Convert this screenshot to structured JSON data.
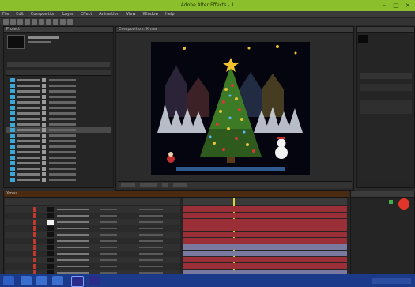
{
  "window": {
    "title": "Adobe After Effects - 1"
  },
  "menu": {
    "items": [
      "File",
      "Edit",
      "Composition",
      "Layer",
      "Effect",
      "Animation",
      "View",
      "Window",
      "Help"
    ]
  },
  "project": {
    "title": "Project"
  },
  "composition": {
    "tab": "Composition: Xmas"
  },
  "viewer": {
    "zoom": "",
    "time": ""
  },
  "timeline": {
    "tab": "Xmas"
  },
  "colors": {
    "accent": "#8bbf2c",
    "layer_bar": "#9a2f38",
    "timeline_label": "#c0392b",
    "taskbar": "#1b3b8a"
  },
  "icons": [
    "minimize-icon",
    "maximize-icon",
    "close-icon",
    "star-icon",
    "snowman-icon",
    "tree-icon"
  ]
}
